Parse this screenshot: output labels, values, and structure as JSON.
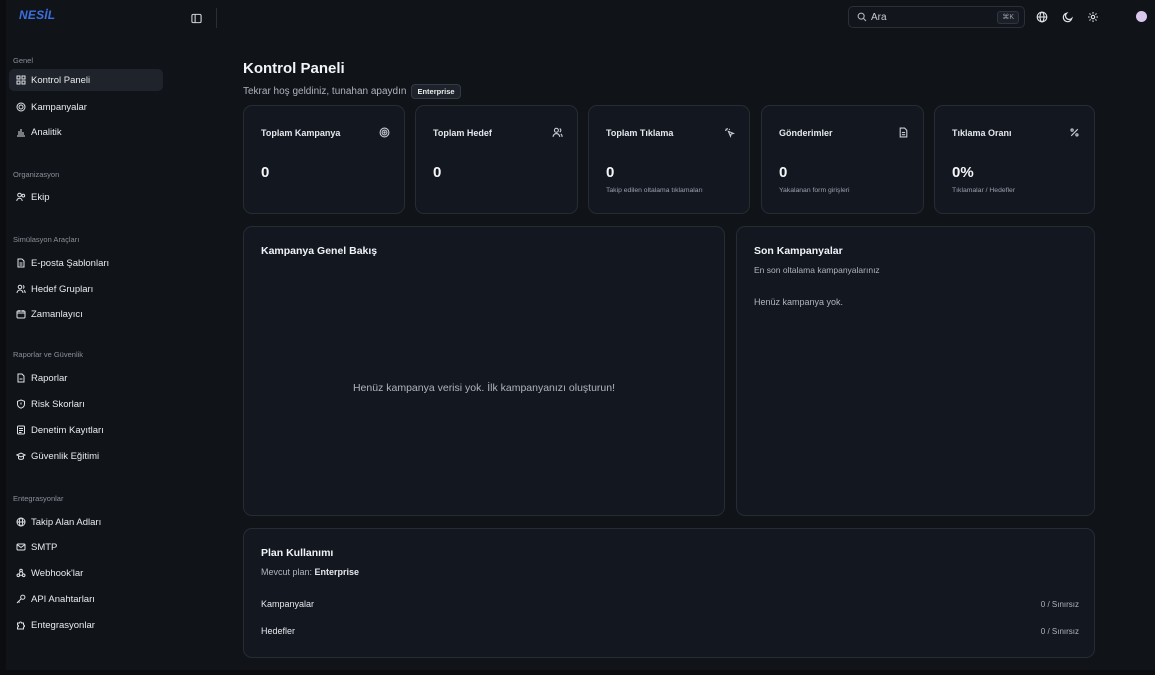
{
  "app": {
    "logo": "NESİL"
  },
  "search": {
    "placeholder": "Ara",
    "shortcut": "⌘K"
  },
  "sidebar": {
    "sections": [
      {
        "title": "Genel",
        "items": [
          {
            "label": "Kontrol Paneli",
            "icon": "dashboard-icon",
            "active": true
          },
          {
            "label": "Kampanyalar",
            "icon": "target-icon"
          },
          {
            "label": "Analitik",
            "icon": "bar-chart-icon"
          }
        ]
      },
      {
        "title": "Organizasyon",
        "items": [
          {
            "label": "Ekip",
            "icon": "users-icon"
          }
        ]
      },
      {
        "title": "Simülasyon Araçları",
        "items": [
          {
            "label": "E-posta Şablonları",
            "icon": "file-text-icon"
          },
          {
            "label": "Hedef Grupları",
            "icon": "users-group-icon"
          },
          {
            "label": "Zamanlayıcı",
            "icon": "calendar-icon"
          }
        ]
      },
      {
        "title": "Raporlar ve Güvenlik",
        "items": [
          {
            "label": "Raporlar",
            "icon": "report-icon"
          },
          {
            "label": "Risk Skorları",
            "icon": "shield-icon"
          },
          {
            "label": "Denetim Kayıtları",
            "icon": "audit-log-icon"
          },
          {
            "label": "Güvenlik Eğitimi",
            "icon": "graduation-cap-icon"
          }
        ]
      },
      {
        "title": "Entegrasyonlar",
        "items": [
          {
            "label": "Takip Alan Adları",
            "icon": "globe-icon"
          },
          {
            "label": "SMTP",
            "icon": "mail-icon"
          },
          {
            "label": "Webhook'lar",
            "icon": "webhook-icon"
          },
          {
            "label": "API Anahtarları",
            "icon": "key-icon"
          },
          {
            "label": "Entegrasyonlar",
            "icon": "puzzle-icon"
          }
        ]
      }
    ]
  },
  "header": {
    "title": "Kontrol Paneli",
    "welcome": "Tekrar hoş geldiniz, tunahan apaydın",
    "plan_badge": "Enterprise"
  },
  "stats": [
    {
      "title": "Toplam Kampanya",
      "value": "0",
      "sub": "",
      "icon": "target-icon"
    },
    {
      "title": "Toplam Hedef",
      "value": "0",
      "sub": "",
      "icon": "users-icon"
    },
    {
      "title": "Toplam Tıklama",
      "value": "0",
      "sub": "Takip edilen oltalama tıklamaları",
      "icon": "click-icon"
    },
    {
      "title": "Gönderimler",
      "value": "0",
      "sub": "Yakalanan form girişleri",
      "icon": "file-icon"
    },
    {
      "title": "Tıklama Oranı",
      "value": "0%",
      "sub": "Tıklamalar / Hedefler",
      "icon": "percent-icon"
    }
  ],
  "overview": {
    "title": "Kampanya Genel Bakış",
    "empty": "Henüz kampanya verisi yok. İlk kampanyanızı oluşturun!"
  },
  "recent": {
    "title": "Son Kampanyalar",
    "subtitle": "En son oltalama kampanyalarınız",
    "empty": "Henüz kampanya yok."
  },
  "plan": {
    "title": "Plan Kullanımı",
    "current_label": "Mevcut plan:",
    "current_value": "Enterprise",
    "rows": [
      {
        "label": "Kampanyalar",
        "value": "0 / Sınırsız"
      },
      {
        "label": "Hedefler",
        "value": "0 / Sınırsız"
      }
    ]
  }
}
